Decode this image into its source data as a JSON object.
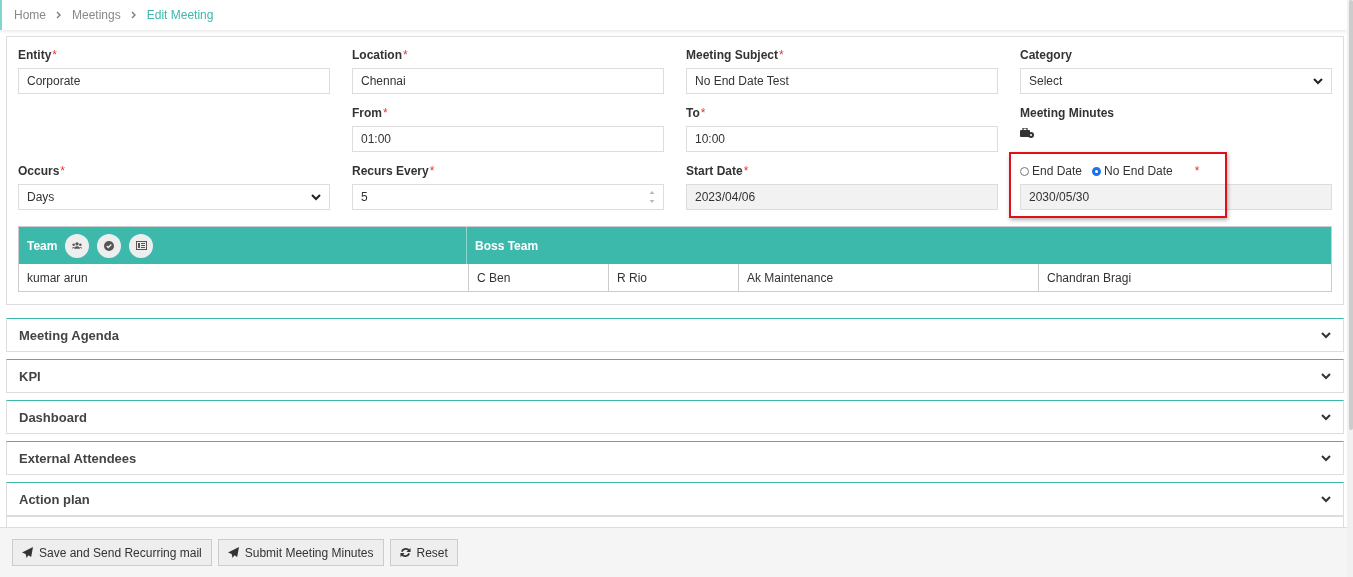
{
  "breadcrumb": [
    {
      "label": "Home",
      "current": false
    },
    {
      "label": "Meetings",
      "current": false
    },
    {
      "label": "Edit Meeting",
      "current": true
    }
  ],
  "form": {
    "rows": [
      [
        {
          "kind": "text",
          "label": "Entity",
          "required_mark": "*",
          "value": "Corporate"
        },
        {
          "kind": "text",
          "label": "Location",
          "required_mark": "*",
          "value": "Chennai"
        },
        {
          "kind": "text",
          "label": "Meeting Subject",
          "required_mark": "*",
          "value": "No End Date Test"
        },
        {
          "kind": "select",
          "label": "Category",
          "value": "Select"
        }
      ],
      [
        "",
        {
          "kind": "text",
          "label": "From",
          "required_mark": "*",
          "value": "01:00"
        },
        {
          "kind": "text",
          "label": "To",
          "required_mark": "*",
          "value": "10:00"
        },
        {
          "kind": "minutes",
          "label": "Meeting Minutes"
        }
      ],
      [
        {
          "kind": "select",
          "label": "Occurs",
          "required_mark": "*",
          "value": "Days"
        },
        {
          "kind": "number",
          "label": "Recurs Every",
          "required_mark": "*",
          "value": "5"
        },
        {
          "kind": "readonly",
          "label": "Start Date",
          "required_mark": "*",
          "value": "2023/04/06"
        },
        {
          "kind": "end",
          "required_mark": "*",
          "highlighted": true,
          "options": [
            {
              "label": "End Date",
              "selected": false
            },
            {
              "label": "No End Date",
              "selected": true
            }
          ],
          "value": "2030/05/30"
        }
      ]
    ]
  },
  "team_table": {
    "team_heading": "Team",
    "boss_heading": "Boss Team",
    "team_member": "kumar arun",
    "boss_members": [
      "C Ben",
      "R Rio",
      "Ak Maintenance",
      "Chandran Bragi"
    ]
  },
  "sections": [
    {
      "title": "Meeting Agenda",
      "expanded": false
    },
    {
      "title": "KPI",
      "expanded": false
    },
    {
      "title": "Dashboard",
      "expanded": false
    },
    {
      "title": "External Attendees",
      "expanded": false
    },
    {
      "title": "Action plan",
      "expanded": false
    }
  ],
  "buttons": [
    {
      "label": "Save and Send Recurring mail",
      "kind": "submit"
    },
    {
      "label": "Submit Meeting Minutes",
      "kind": "submit"
    },
    {
      "label": "Reset",
      "kind": "reset"
    }
  ]
}
